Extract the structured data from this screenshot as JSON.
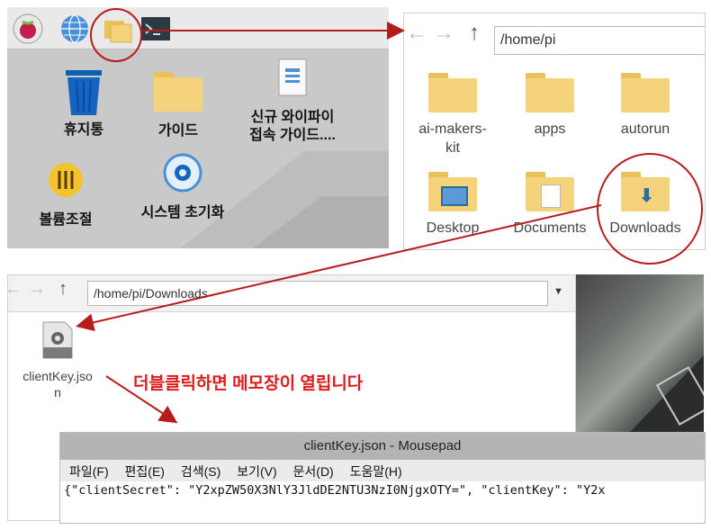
{
  "desktop": {
    "items": [
      {
        "label": "휴지통"
      },
      {
        "label": "가이드"
      },
      {
        "label_line1": "신규 와이파이",
        "label_line2": "접속 가이드...."
      },
      {
        "label": "볼륨조절"
      },
      {
        "label": "시스템 초기화"
      }
    ]
  },
  "file_manager_top": {
    "path": "/home/pi",
    "items": [
      {
        "label_line1": "ai-makers-",
        "label_line2": "kit"
      },
      {
        "label": "apps"
      },
      {
        "label": "autorun"
      },
      {
        "label": "Desktop"
      },
      {
        "label": "Documents"
      },
      {
        "label": "Downloads"
      }
    ]
  },
  "file_manager_bottom": {
    "path": "/home/pi/Downloads",
    "file": {
      "label_line1": "clientKey.jso",
      "label_line2": "n"
    }
  },
  "annotation": "더블클릭하면 메모장이 열립니다",
  "mousepad": {
    "title": "clientKey.json - Mousepad",
    "menu": [
      "파일(F)",
      "편집(E)",
      "검색(S)",
      "보기(V)",
      "문서(D)",
      "도움말(H)"
    ],
    "content": "{\"clientSecret\": \"Y2xpZW50X3NlY3JldDE2NTU3NzI0NjgxOTY=\", \"clientKey\": \"Y2x"
  },
  "colors": {
    "annotation_red": "#b51d1d",
    "folder": "#f5d37a",
    "highlight_red": "#b51d1d"
  }
}
